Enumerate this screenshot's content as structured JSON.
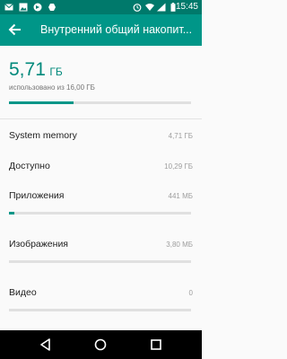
{
  "status_bar": {
    "time": "15:45",
    "left_icons": [
      "mail-icon",
      "image-icon",
      "sync-icon",
      "cloud-icon"
    ],
    "right_icons": [
      "alarm-icon",
      "wifi-icon",
      "cell-signal-icon",
      "battery-icon"
    ]
  },
  "app_bar": {
    "title": "Внутренний общий накопит..."
  },
  "summary": {
    "used_value": "5,71",
    "used_unit": "ГБ",
    "used_of_text": "использовано из 16,00 ГБ",
    "used_fraction": 0.357
  },
  "rows": [
    {
      "label": "System memory",
      "value": "4,71 ГБ",
      "has_bar": false,
      "fraction": 0
    },
    {
      "label": "Доступно",
      "value": "10,29 ГБ",
      "has_bar": false,
      "fraction": 0
    },
    {
      "label": "Приложения",
      "value": "441 МБ",
      "has_bar": true,
      "fraction": 0.03
    },
    {
      "label": "Изображения",
      "value": "3,80 МБ",
      "has_bar": true,
      "fraction": 0.0
    },
    {
      "label": "Видео",
      "value": "0",
      "has_bar": true,
      "fraction": 0.0
    }
  ],
  "nav_bar": {
    "buttons": [
      "back-triangle-icon",
      "home-circle-icon",
      "recents-square-icon"
    ]
  },
  "colors": {
    "status_bar": "#00796b",
    "app_bar": "#009688",
    "accent": "#009688",
    "used_text": "#00897b"
  }
}
